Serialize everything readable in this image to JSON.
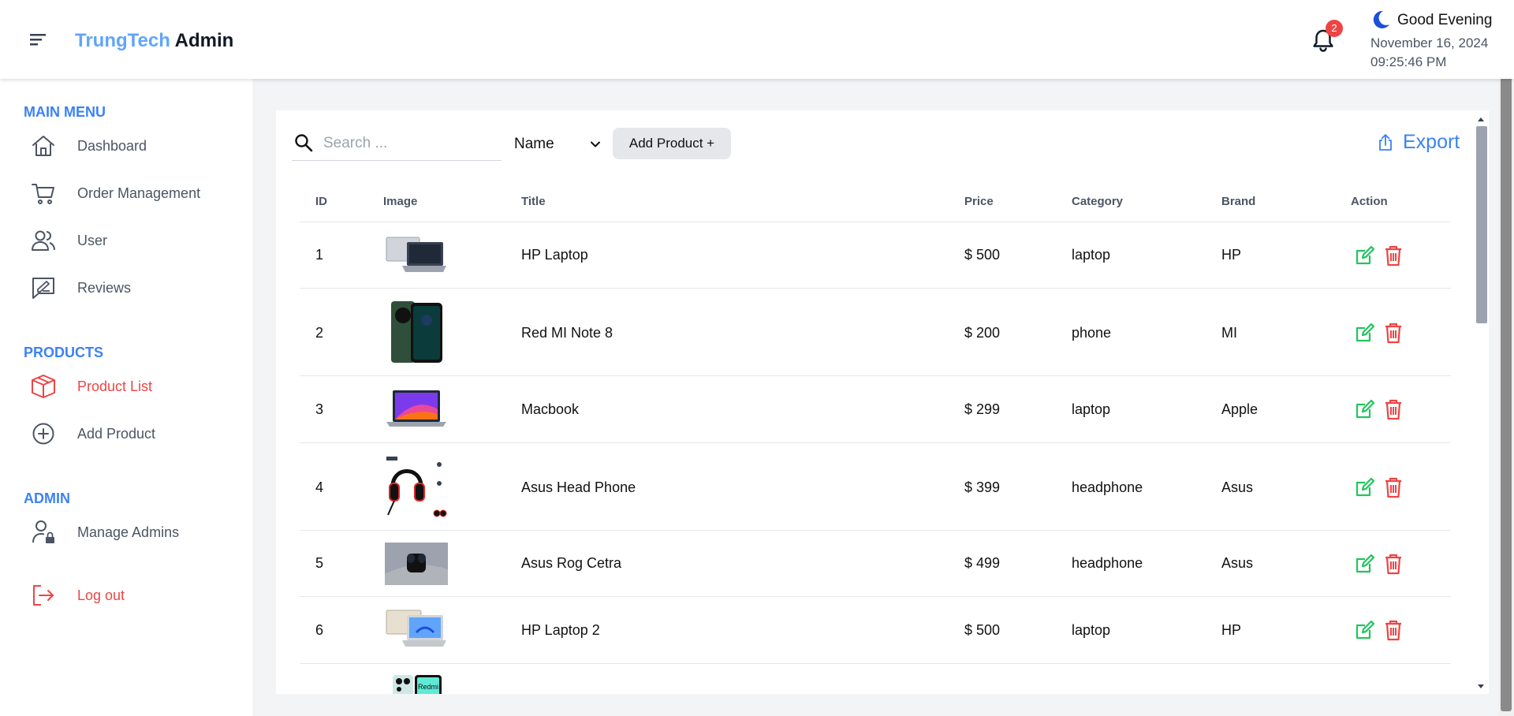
{
  "header": {
    "brand_part1": "TrungTech",
    "brand_part2": "Admin",
    "notifications_count": "2",
    "greeting": "Good Evening",
    "date": "November 16, 2024",
    "time": "09:25:46 PM"
  },
  "sidebar": {
    "main_menu_title": "MAIN MENU",
    "main_items": [
      {
        "label": "Dashboard",
        "icon": "home-icon"
      },
      {
        "label": "Order Management",
        "icon": "cart-icon"
      },
      {
        "label": "User",
        "icon": "users-icon"
      },
      {
        "label": "Reviews",
        "icon": "reviews-icon"
      }
    ],
    "products_title": "PRODUCTS",
    "product_items": [
      {
        "label": "Product List",
        "icon": "box-icon",
        "active": true
      },
      {
        "label": "Add Product",
        "icon": "plus-circle-icon"
      }
    ],
    "admin_title": "ADMIN",
    "admin_items": [
      {
        "label": "Manage Admins",
        "icon": "user-lock-icon"
      }
    ],
    "logout_label": "Log out"
  },
  "toolbar": {
    "search_placeholder": "Search ...",
    "filter_value": "Name",
    "add_product_label": "Add Product +",
    "export_label": "Export"
  },
  "table": {
    "columns": [
      "ID",
      "Image",
      "Title",
      "Price",
      "Category",
      "Brand",
      "Action"
    ],
    "rows": [
      {
        "id": "1",
        "title": "HP Laptop",
        "price": "$ 500",
        "category": "laptop",
        "brand": "HP",
        "image": "laptop-silver"
      },
      {
        "id": "2",
        "title": "Red MI Note 8",
        "price": "$ 200",
        "category": "phone",
        "brand": "MI",
        "image": "phone-green"
      },
      {
        "id": "3",
        "title": "Macbook",
        "price": "$ 299",
        "category": "laptop",
        "brand": "Apple",
        "image": "macbook"
      },
      {
        "id": "4",
        "title": "Asus Head Phone",
        "price": "$ 399",
        "category": "headphone",
        "brand": "Asus",
        "image": "headphone-black-red"
      },
      {
        "id": "5",
        "title": "Asus Rog Cetra",
        "price": "$ 499",
        "category": "headphone",
        "brand": "Asus",
        "image": "earbuds"
      },
      {
        "id": "6",
        "title": "HP Laptop 2",
        "price": "$ 500",
        "category": "laptop",
        "brand": "HP",
        "image": "laptop-blue"
      }
    ],
    "partial_row_image": "phone-redmi",
    "partial_row_brand_text": "Redmi"
  },
  "colors": {
    "accent": "#3b82f6",
    "brand_light": "#60a5fa",
    "danger": "#ef4444",
    "edit_green": "#22c55e",
    "main_bg": "#f3f4f6"
  }
}
